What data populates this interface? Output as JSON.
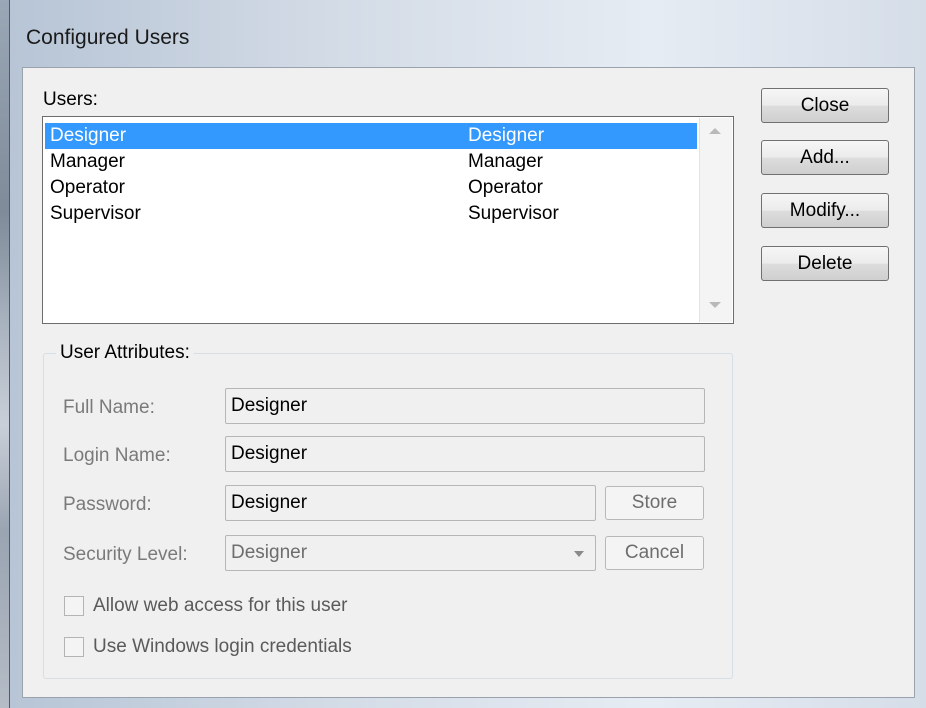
{
  "window": {
    "title": "Configured Users"
  },
  "users": {
    "label": "Users:",
    "rows": [
      {
        "name": "Designer",
        "level": "Designer",
        "selected": true
      },
      {
        "name": "Manager",
        "level": "Manager",
        "selected": false
      },
      {
        "name": "Operator",
        "level": "Operator",
        "selected": false
      },
      {
        "name": "Supervisor",
        "level": "Supervisor",
        "selected": false
      }
    ]
  },
  "buttons": {
    "close": "Close",
    "add": "Add...",
    "modify": "Modify...",
    "delete": "Delete"
  },
  "attributes": {
    "title": "User Attributes:",
    "full_name_label": "Full Name:",
    "full_name_value": "Designer",
    "login_name_label": "Login Name:",
    "login_name_value": "Designer",
    "password_label": "Password:",
    "password_value": "Designer",
    "security_level_label": "Security Level:",
    "security_level_value": "Designer",
    "store_label": "Store",
    "cancel_label": "Cancel",
    "allow_web_label": "Allow web access for this user",
    "allow_web_checked": false,
    "use_windows_label": "Use Windows login credentials",
    "use_windows_checked": false
  },
  "icons": {
    "scroll_up": "chevron-up-icon",
    "scroll_down": "chevron-down-icon",
    "combo": "dropdown-arrow-icon"
  },
  "colors": {
    "selection": "#3399ff",
    "dialog_bg": "#f0f0f0",
    "disabled_text": "#7a7a7a"
  }
}
